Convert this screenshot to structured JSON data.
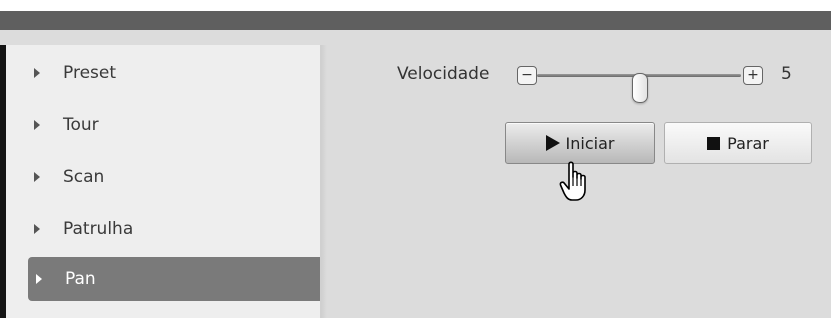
{
  "sidebar": {
    "items": [
      {
        "label": "Preset",
        "active": false
      },
      {
        "label": "Tour",
        "active": false
      },
      {
        "label": "Scan",
        "active": false
      },
      {
        "label": "Patrulha",
        "active": false
      },
      {
        "label": "Pan",
        "active": true
      }
    ]
  },
  "speed": {
    "label": "Velocidade",
    "minus_symbol": "−",
    "plus_symbol": "+",
    "value": "5",
    "slider_fraction": 0.5
  },
  "buttons": {
    "start_label": "Iniciar",
    "stop_label": "Parar"
  },
  "icons": {
    "list_arrow": "caret-right-icon",
    "start": "play-icon",
    "stop": "stop-icon",
    "pointer": "hand-pointer-icon"
  },
  "colors": {
    "header": "#5f5f5f",
    "sidebar_bg": "#eeeeee",
    "active_item": "#7a7a7a",
    "panel_bg": "#dcdcdc"
  }
}
